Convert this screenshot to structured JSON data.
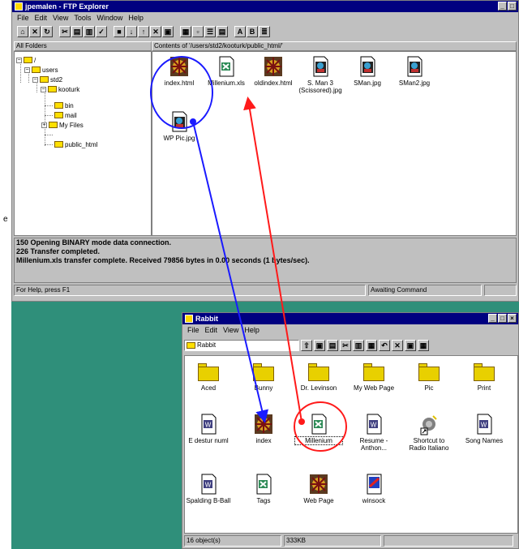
{
  "side_text": "e",
  "ftp": {
    "title": "jpemalen - FTP Explorer",
    "menu": [
      "File",
      "Edit",
      "View",
      "Tools",
      "Window",
      "Help"
    ],
    "all_folders": "All Folders",
    "contents_header": "Contents of '/users/std2/kooturk/public_html/'",
    "tree": [
      {
        "label": "/",
        "expander": "−"
      },
      {
        "label": "users",
        "expander": "−"
      },
      {
        "label": "std2",
        "expander": "−"
      },
      {
        "label": "kooturk",
        "expander": "−"
      },
      {
        "label": "bin",
        "expander": ""
      },
      {
        "label": "mail",
        "expander": ""
      },
      {
        "label": "My Files",
        "expander": "+"
      },
      {
        "label": "public_html",
        "expander": ""
      }
    ],
    "files": [
      {
        "label": "index.html",
        "icon": "web-page-icon"
      },
      {
        "label": "Millenium.xls",
        "icon": "excel-file-icon"
      },
      {
        "label": "oldindex.html",
        "icon": "web-page-icon"
      },
      {
        "label": "S. Man 3 (Scissored).jpg",
        "icon": "image-file-icon"
      },
      {
        "label": "SMan.jpg",
        "icon": "image-file-icon"
      },
      {
        "label": "SMan2.jpg",
        "icon": "image-file-icon"
      },
      {
        "label": "WP Pic.jpg",
        "icon": "image-file-icon"
      }
    ],
    "log": [
      "150 Opening BINARY mode data connection.",
      "226 Transfer completed.",
      "Millenium.xls transfer complete.  Received 79856 bytes in 0.00 seconds (1 bytes/sec)."
    ],
    "status_help": "For Help, press F1",
    "status_state": "Awaiting Command"
  },
  "explorer": {
    "title": "Rabbit",
    "menu": [
      "File",
      "Edit",
      "View",
      "Help"
    ],
    "address": "Rabbit",
    "items": [
      {
        "label": "Aced",
        "icon": "folder-icon"
      },
      {
        "label": "Bunny",
        "icon": "folder-icon"
      },
      {
        "label": "Dr. Levinson",
        "icon": "folder-icon"
      },
      {
        "label": "My Web Page",
        "icon": "folder-icon"
      },
      {
        "label": "Pic",
        "icon": "folder-icon"
      },
      {
        "label": "Print",
        "icon": "folder-icon"
      },
      {
        "label": "E destur numl",
        "icon": "word-doc-icon"
      },
      {
        "label": "index",
        "icon": "web-page-icon"
      },
      {
        "label": "Millenium",
        "icon": "excel-file-icon"
      },
      {
        "label": "Resume - Anthon...",
        "icon": "word-doc-icon"
      },
      {
        "label": "Shortcut to Radio Italiano",
        "icon": "shortcut-icon"
      },
      {
        "label": "Song Names",
        "icon": "word-doc-icon"
      },
      {
        "label": "Spalding B-Ball",
        "icon": "word-doc-icon"
      },
      {
        "label": "Tags",
        "icon": "excel-file-icon"
      },
      {
        "label": "Web Page",
        "icon": "web-page-icon"
      },
      {
        "label": "winsock",
        "icon": "app-icon"
      }
    ],
    "status_count": "16 object(s)",
    "status_size": "333KB"
  },
  "colors": {
    "annotation_blue": "#1a1aff",
    "annotation_red": "#ff1a1a",
    "desktop": "#2f8f7a",
    "titlebar": "#000080"
  }
}
